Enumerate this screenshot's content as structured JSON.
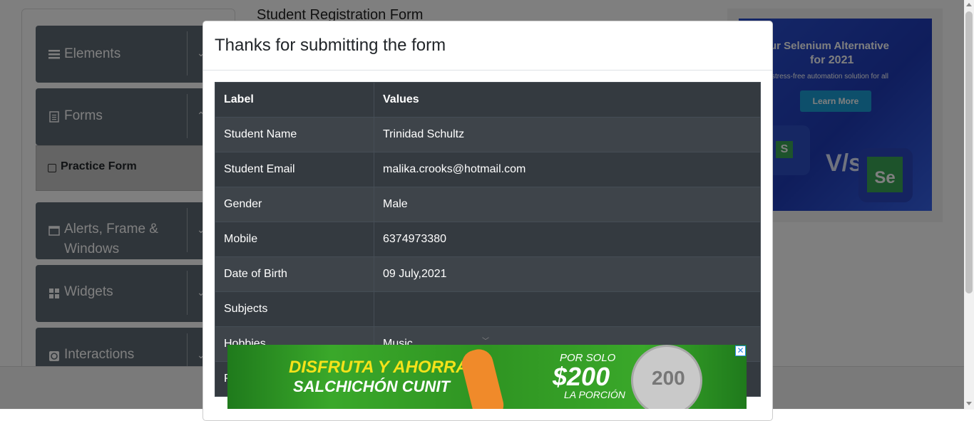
{
  "sidebar": {
    "groups": [
      {
        "label": "Elements",
        "icon": "hamburger-icon"
      },
      {
        "label": "Forms",
        "icon": "document-icon"
      },
      {
        "label": "Alerts, Frame & Windows",
        "icon": "window-icon"
      },
      {
        "label": "Widgets",
        "icon": "grid-icon"
      },
      {
        "label": "Interactions",
        "icon": "sync-icon"
      }
    ],
    "active_item": "Practice Form"
  },
  "page": {
    "title": "Student Registration Form"
  },
  "top_ad": {
    "line1": "ur Selenium Alternative",
    "line2": "for 2021",
    "line3": "stress-free automation solution for all",
    "button": "Learn More",
    "vs": "V/s",
    "logo_a": "S",
    "logo_b": "Se"
  },
  "modal": {
    "title": "Thanks for submitting the form",
    "headers": {
      "label": "Label",
      "values": "Values"
    },
    "rows": [
      {
        "label": "Student Name",
        "value": "Trinidad Schultz"
      },
      {
        "label": "Student Email",
        "value": "malika.crooks@hotmail.com"
      },
      {
        "label": "Gender",
        "value": "Male"
      },
      {
        "label": "Mobile",
        "value": "6374973380"
      },
      {
        "label": "Date of Birth",
        "value": "09 July,2021"
      },
      {
        "label": "Subjects",
        "value": ""
      },
      {
        "label": "Hobbies",
        "value": "Music"
      },
      {
        "label": "P",
        "value": ""
      }
    ]
  },
  "bottom_ad": {
    "line1": "DISFRUTA Y AHORRA",
    "line2": "SALCHICHÓN CUNIT",
    "por_solo": "POR SOLO",
    "price": "$200",
    "porcion": "LA PORCIÓN",
    "coin": "200",
    "close": "✕"
  }
}
